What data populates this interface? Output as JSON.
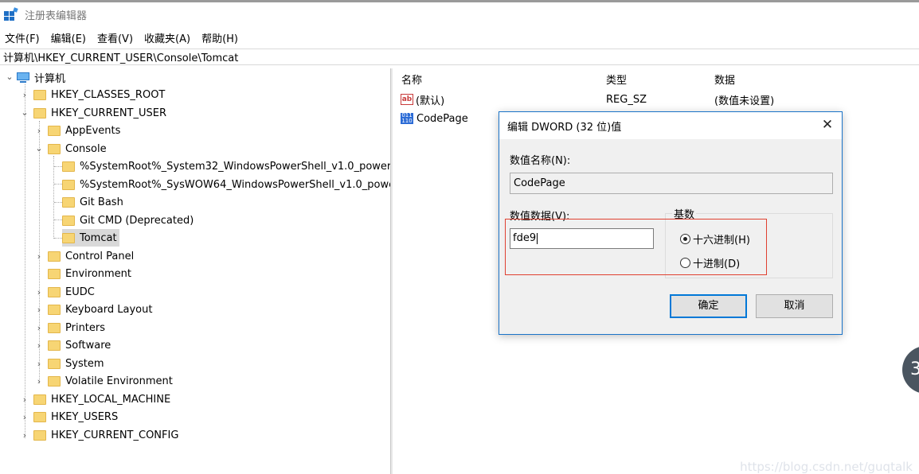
{
  "window": {
    "title": "注册表编辑器"
  },
  "menu": [
    "文件(F)",
    "编辑(E)",
    "查看(V)",
    "收藏夹(A)",
    "帮助(H)"
  ],
  "address": "计算机\\HKEY_CURRENT_USER\\Console\\Tomcat",
  "tree": {
    "root": "计算机",
    "hkcr": "HKEY_CLASSES_ROOT",
    "hkcu": "HKEY_CURRENT_USER",
    "appevents": "AppEvents",
    "console": "Console",
    "console_children": [
      "%SystemRoot%_System32_WindowsPowerShell_v1.0_powers",
      "%SystemRoot%_SysWOW64_WindowsPowerShell_v1.0_powe",
      "Git Bash",
      "Git CMD (Deprecated)",
      "Tomcat"
    ],
    "hkcu_rest": [
      "Control Panel",
      "Environment",
      "EUDC",
      "Keyboard Layout",
      "Printers",
      "Software",
      "System",
      "Volatile Environment"
    ],
    "hklm": "HKEY_LOCAL_MACHINE",
    "hku": "HKEY_USERS",
    "hkcc": "HKEY_CURRENT_CONFIG"
  },
  "values_pane": {
    "headers": {
      "name": "名称",
      "type": "类型",
      "data": "数据"
    },
    "rows": [
      {
        "name": "(默认)",
        "type": "REG_SZ",
        "data": "(数值未设置)",
        "icon": "string-value-icon"
      },
      {
        "name": "CodePage",
        "type": "",
        "data": "",
        "icon": "binary-value-icon"
      }
    ]
  },
  "dialog": {
    "title": "编辑 DWORD (32 位)值",
    "close": "✕",
    "name_label": "数值名称(N):",
    "name_value": "CodePage",
    "data_label": "数值数据(V):",
    "data_value": "fde9",
    "base_label": "基数",
    "radio_hex": "十六进制(H)",
    "radio_dec": "十进制(D)",
    "selected_base": "hex",
    "ok": "确定",
    "cancel": "取消"
  },
  "watermark": "https://blog.csdn.net/guqtalk",
  "side_bubble": "3",
  "colors": {
    "highlight": "#e04030",
    "accent": "#0078d7"
  }
}
